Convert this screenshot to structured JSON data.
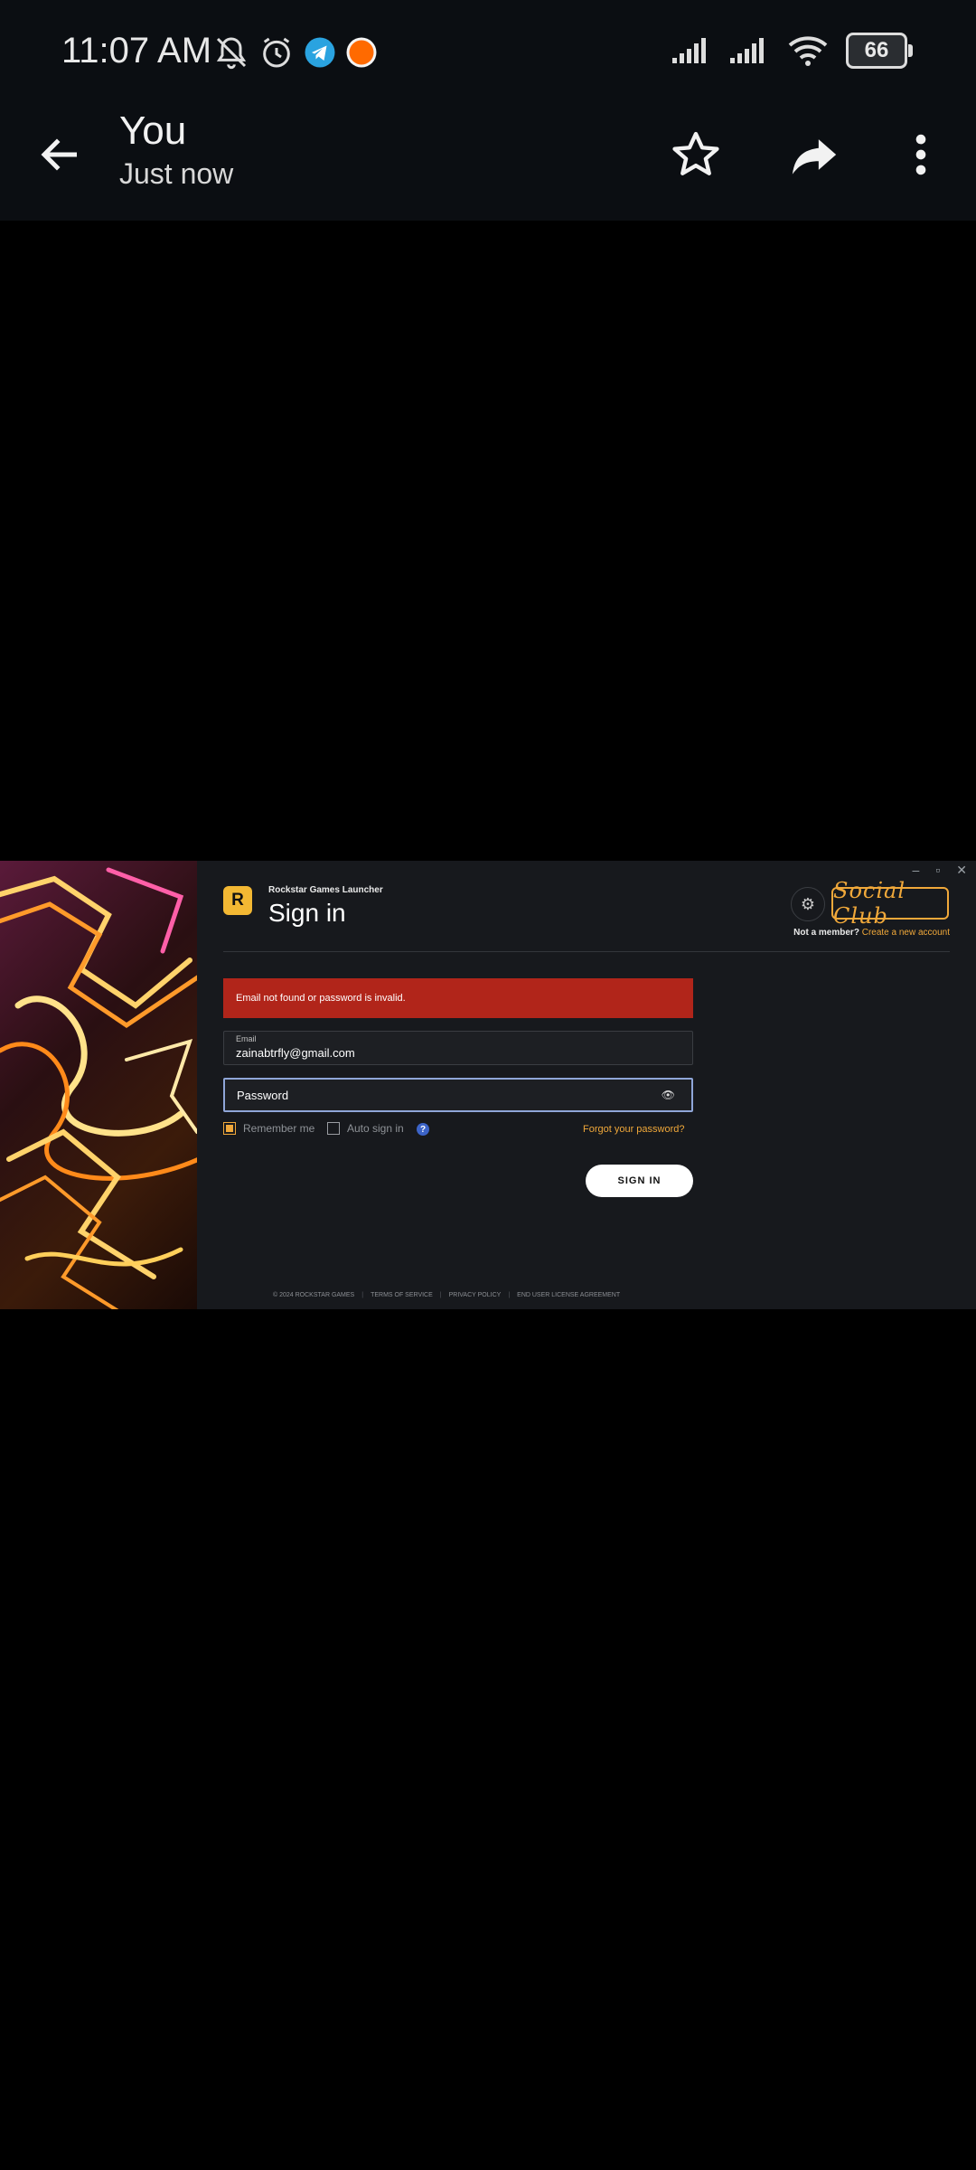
{
  "status_bar": {
    "time": "11:07 AM",
    "battery": "66",
    "icons_left": [
      "bell-off-icon",
      "alarm-icon",
      "telegram-icon",
      "app-notification-icon"
    ],
    "icons_right": [
      "signal-icon",
      "signal-icon",
      "wifi-icon",
      "battery-icon"
    ]
  },
  "app_bar": {
    "title": "You",
    "subtitle": "Just now"
  },
  "launcher": {
    "app_name": "Rockstar Games Launcher",
    "logo_letter": "R",
    "heading": "Sign in",
    "social_club_logo": "Social Club",
    "member_question": "Not a member?",
    "create_account": "Create a new account",
    "error_message": "Email not found or password is invalid.",
    "email_label": "Email",
    "email_value": "zainabtrfly@gmail.com",
    "password_placeholder": "Password",
    "remember_me": "Remember me",
    "auto_sign_in": "Auto sign in",
    "help_glyph": "?",
    "forgot_password": "Forgot your password?",
    "sign_in_button": "SIGN IN",
    "footer": {
      "copyright": "© 2024 ROCKSTAR GAMES",
      "terms": "TERMS OF SERVICE",
      "privacy": "PRIVACY POLICY",
      "eula": "END USER LICENSE AGREEMENT"
    }
  },
  "colors": {
    "accent": "#f0a83a",
    "error": "#b1251a",
    "bar_background": "#0b0e12",
    "panel_background": "#17191d"
  }
}
